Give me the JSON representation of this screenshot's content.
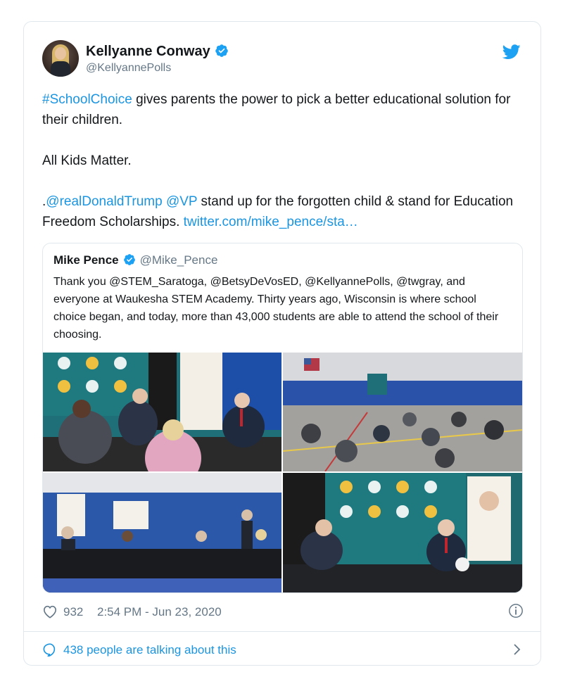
{
  "author": {
    "name": "Kellyanne Conway",
    "handle": "@KellyannePolls",
    "verified": true
  },
  "tweet": {
    "p1_link": "#SchoolChoice",
    "p1_text": " gives parents the power to pick a better educational solution for their children.",
    "p2": "All Kids Matter.",
    "p3_prefix": ".",
    "p3_link1": "@realDonaldTrump",
    "p3_space": " ",
    "p3_link2": "@VP",
    "p3_text": " stand up for the forgotten child & stand for Education Freedom Scholarships. ",
    "p3_url": "twitter.com/mike_pence/sta…"
  },
  "quote": {
    "name": "Mike Pence",
    "handle": "@Mike_Pence",
    "text": "Thank you @STEM_Saratoga, @BetsyDeVosED, @KellyannePolls, @twgray, and everyone at Waukesha STEM Academy. Thirty years ago, Wisconsin is where school choice began, and today, more than 43,000 students are able to attend the school of their choosing."
  },
  "footer": {
    "likes": "932",
    "timestamp": "2:54 PM - Jun 23, 2020",
    "conversation": "438 people are talking about this"
  },
  "colors": {
    "link": "#1b95e0",
    "muted": "#657786",
    "border": "#e1e8ed"
  }
}
